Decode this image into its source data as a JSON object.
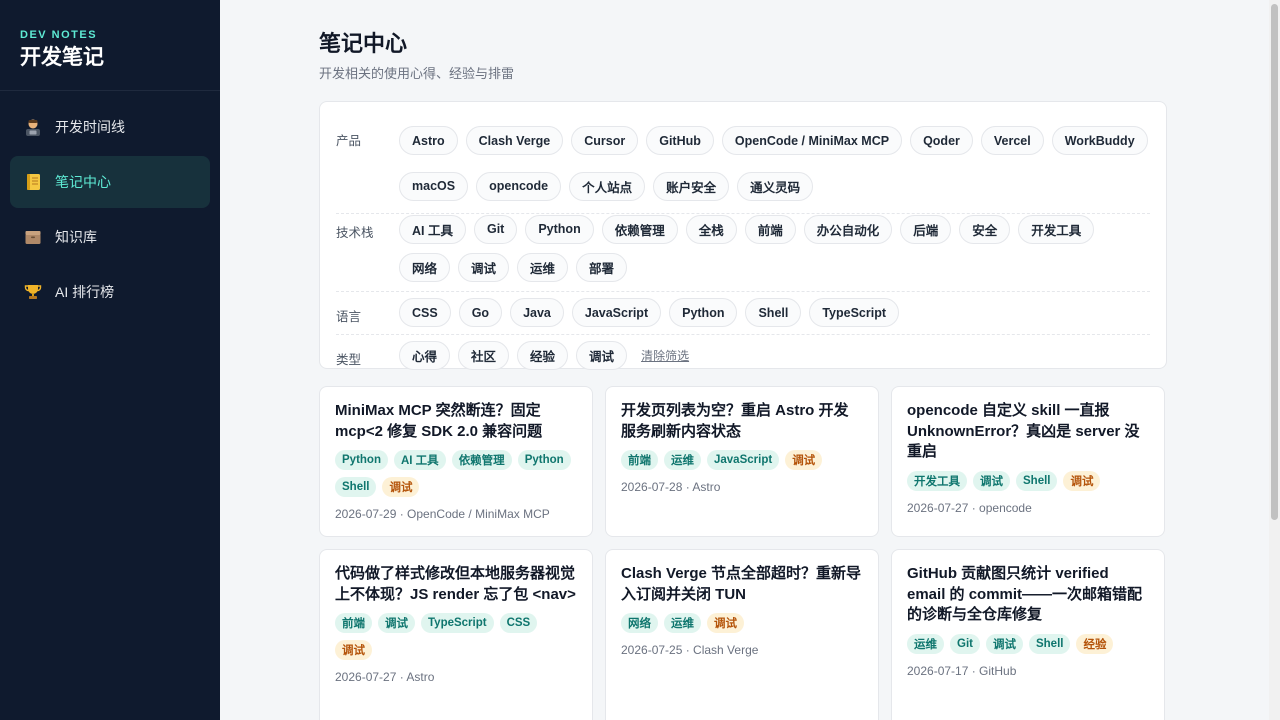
{
  "brand": {
    "sub": "DEV NOTES",
    "title": "开发笔记"
  },
  "nav": [
    {
      "label": "开发时间线",
      "icon": "technologist-icon",
      "active": false
    },
    {
      "label": "笔记中心",
      "icon": "notebook-icon",
      "active": true
    },
    {
      "label": "知识库",
      "icon": "file-box-icon",
      "active": false
    },
    {
      "label": "AI 排行榜",
      "icon": "trophy-icon",
      "active": false
    }
  ],
  "page": {
    "title": "笔记中心",
    "subtitle": "开发相关的使用心得、经验与排雷"
  },
  "filters": {
    "product": {
      "label": "产品",
      "chips": [
        "Astro",
        "Clash Verge",
        "Cursor",
        "GitHub",
        "OpenCode / MiniMax MCP",
        "Qoder",
        "Vercel",
        "WorkBuddy",
        "macOS",
        "opencode",
        "个人站点",
        "账户安全",
        "通义灵码"
      ]
    },
    "tech": {
      "label": "技术栈",
      "chips": [
        "AI 工具",
        "Git",
        "Python",
        "依赖管理",
        "全栈",
        "前端",
        "办公自动化",
        "后端",
        "安全",
        "开发工具",
        "网络",
        "调试",
        "运维",
        "部署"
      ]
    },
    "lang": {
      "label": "语言",
      "chips": [
        "CSS",
        "Go",
        "Java",
        "JavaScript",
        "Python",
        "Shell",
        "TypeScript"
      ]
    },
    "type": {
      "label": "类型",
      "chips": [
        "心得",
        "社区",
        "经验",
        "调试"
      ],
      "clear": "清除筛选"
    }
  },
  "cards": [
    {
      "title": "MiniMax MCP 突然断连？固定 mcp<2 修复 SDK 2.0 兼容问题",
      "tags": [
        {
          "t": "Python"
        },
        {
          "t": "AI 工具"
        },
        {
          "t": "依赖管理"
        },
        {
          "t": "Python"
        },
        {
          "t": "Shell"
        },
        {
          "t": "调试",
          "warn": true
        }
      ],
      "meta": "2026-07-29 · OpenCode / MiniMax MCP"
    },
    {
      "title": "开发页列表为空？重启 Astro 开发服务刷新内容状态",
      "tags": [
        {
          "t": "前端"
        },
        {
          "t": "运维"
        },
        {
          "t": "JavaScript"
        },
        {
          "t": "调试",
          "warn": true
        }
      ],
      "meta": "2026-07-28 · Astro"
    },
    {
      "title": "opencode 自定义 skill 一直报 UnknownError？真凶是 server 没重启",
      "tags": [
        {
          "t": "开发工具"
        },
        {
          "t": "调试"
        },
        {
          "t": "Shell"
        },
        {
          "t": "调试",
          "warn": true
        }
      ],
      "meta": "2026-07-27 · opencode"
    },
    {
      "title": "代码做了样式修改但本地服务器视觉上不体现？JS render 忘了包 <nav>",
      "tags": [
        {
          "t": "前端"
        },
        {
          "t": "调试"
        },
        {
          "t": "TypeScript"
        },
        {
          "t": "CSS"
        },
        {
          "t": "调试",
          "warn": true
        }
      ],
      "meta": "2026-07-27 · Astro"
    },
    {
      "title": "Clash Verge 节点全部超时？重新导入订阅并关闭 TUN",
      "tags": [
        {
          "t": "网络"
        },
        {
          "t": "运维"
        },
        {
          "t": "调试",
          "warn": true
        }
      ],
      "meta": "2026-07-25 · Clash Verge"
    },
    {
      "title": "GitHub 贡献图只统计 verified email 的 commit——一次邮箱错配的诊断与全仓库修复",
      "tags": [
        {
          "t": "运维"
        },
        {
          "t": "Git"
        },
        {
          "t": "调试"
        },
        {
          "t": "Shell"
        },
        {
          "t": "经验",
          "warn": true
        }
      ],
      "meta": "2026-07-17 · GitHub"
    }
  ]
}
